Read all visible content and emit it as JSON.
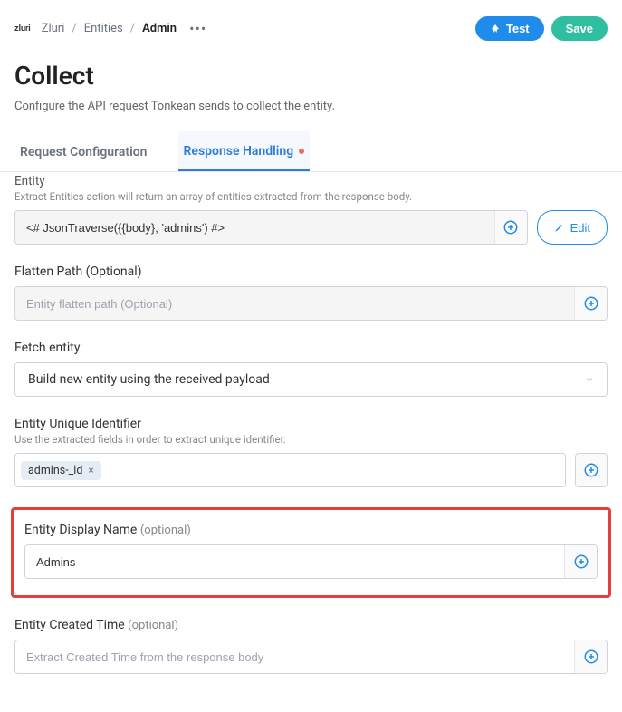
{
  "breadcrumb": {
    "logo": "zluri",
    "items": [
      "Zluri",
      "Entities"
    ],
    "current": "Admin"
  },
  "actions": {
    "test": "Test",
    "save": "Save"
  },
  "page": {
    "title": "Collect",
    "subtitle": "Configure the API request Tonkean sends to collect the entity."
  },
  "tabs": {
    "request": "Request Configuration",
    "response": "Response Handling"
  },
  "entity_section": {
    "label": "Entity",
    "help": "Extract Entities action will return an array of entities extracted from the response body.",
    "value": "<# JsonTraverse({{body}, 'admins') #>",
    "edit": "Edit"
  },
  "flatten_section": {
    "label": "Flatten Path (Optional)",
    "placeholder": "Entity flatten path (Optional)"
  },
  "fetch_section": {
    "label": "Fetch entity",
    "selected": "Build new entity using the received payload"
  },
  "uid_section": {
    "label": "Entity Unique Identifier",
    "help": "Use the extracted fields in order to extract unique identifier.",
    "tag": "admins-_id"
  },
  "display_section": {
    "label": "Entity Display Name ",
    "optional": "(optional)",
    "value": "Admins"
  },
  "created_section": {
    "label": "Entity Created Time ",
    "optional": "(optional)",
    "placeholder": "Extract Created Time from the response body"
  }
}
